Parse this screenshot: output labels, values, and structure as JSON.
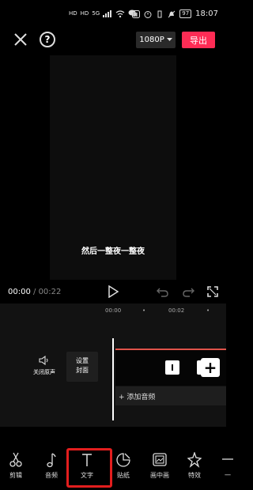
{
  "status_bar": {
    "net_labels": [
      "HD",
      "HD"
    ],
    "signal_label": "5G",
    "battery": "97",
    "time": "18:07"
  },
  "top_bar": {
    "resolution": "1080P",
    "export_label": "导出"
  },
  "preview": {
    "caption": "然后一整夜一整夜"
  },
  "playback": {
    "current_time": "00:00",
    "separator": " / ",
    "total_time": "00:22"
  },
  "timeline": {
    "ruler": [
      "00:00",
      "00:02"
    ],
    "mute_label": "关闭原声",
    "cover_label_1": "设置",
    "cover_label_2": "封面",
    "add_audio": "+ 添加音频"
  },
  "toolbar": {
    "items": [
      {
        "label": "剪辑",
        "icon": "scissors-icon"
      },
      {
        "label": "音频",
        "icon": "music-note-icon"
      },
      {
        "label": "文字",
        "icon": "text-icon"
      },
      {
        "label": "贴纸",
        "icon": "sticker-icon"
      },
      {
        "label": "画中画",
        "icon": "picture-in-picture-icon"
      },
      {
        "label": "特效",
        "icon": "sparkle-star-icon"
      },
      {
        "label": "一",
        "icon": "more-icon"
      }
    ]
  },
  "colors": {
    "accent": "#fe2c55",
    "highlight": "#e31e1e",
    "track_line": "#e0534a"
  }
}
